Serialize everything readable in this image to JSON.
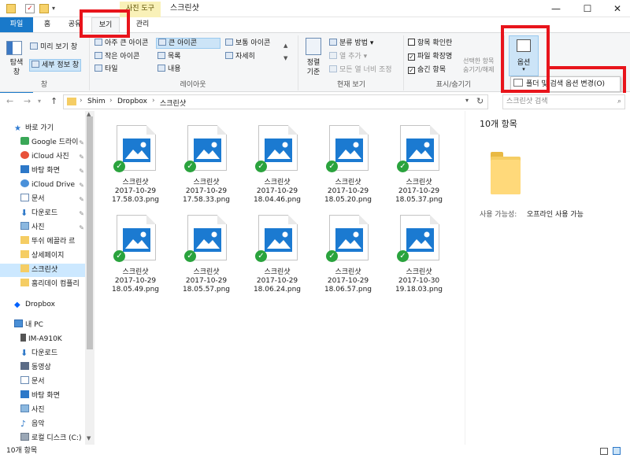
{
  "window": {
    "title": "스크린샷",
    "context_tab": "사진 도구",
    "controls": {
      "minimize": "—",
      "maximize": "☐",
      "close": "✕"
    }
  },
  "tabs": [
    {
      "label": "파일"
    },
    {
      "label": "홈"
    },
    {
      "label": "공유"
    },
    {
      "label": "보기"
    },
    {
      "label": "관리"
    }
  ],
  "ribbon": {
    "panes": {
      "nav_pane": "탐색\n창",
      "preview": "미리 보기 창",
      "details": "세부 정보 창",
      "label": "창"
    },
    "layout": {
      "items": [
        "아주 큰 아이콘",
        "큰 아이콘",
        "보통 아이콘",
        "작은 아이콘",
        "목록",
        "자세히",
        "타일",
        "내용"
      ],
      "label": "레이아웃"
    },
    "current_view": {
      "sort": "정렬\n기준",
      "group_by": "분류 방법",
      "add_columns": "열 추가",
      "fit_columns": "모든 열 너비 조정",
      "label": "현재 보기"
    },
    "show_hide": {
      "item_checkboxes": "항목 확인란",
      "file_extensions": "파일 확장명",
      "hidden_items": "숨긴 항목",
      "hide_selected": "선택한 항목\n숨기기/해제",
      "label": "표시/숨기기"
    },
    "options": {
      "label": "옵션"
    },
    "dropdown": {
      "change_options": "폴더 및 검색 옵션 변경(O)"
    }
  },
  "address": {
    "path": [
      "Shim",
      "Dropbox",
      "스크린샷"
    ],
    "search_placeholder": "스크린샷 검색"
  },
  "nav": {
    "items": [
      {
        "label": "바로 가기",
        "icon": "star-icon"
      },
      {
        "label": "Google 드라이",
        "icon": "google-drive-icon",
        "pinned": true
      },
      {
        "label": "iCloud 사진",
        "icon": "icloud-photos-icon",
        "pinned": true
      },
      {
        "label": "바탕 화면",
        "icon": "desktop-icon",
        "pinned": true
      },
      {
        "label": "iCloud Drive",
        "icon": "icloud-drive-icon",
        "pinned": true
      },
      {
        "label": "문서",
        "icon": "documents-icon",
        "pinned": true
      },
      {
        "label": "다운로드",
        "icon": "download-icon",
        "pinned": true
      },
      {
        "label": "사진",
        "icon": "pictures-icon",
        "pinned": true
      },
      {
        "label": "뚜쉬 에끌라 르",
        "icon": "folder-icon"
      },
      {
        "label": "상세페이지",
        "icon": "folder-icon"
      },
      {
        "label": "스크린샷",
        "icon": "folder-sync-icon",
        "selected": true
      },
      {
        "label": "홈리데이 컴플리",
        "icon": "folder-icon"
      },
      {
        "label": "Dropbox",
        "icon": "dropbox-icon"
      },
      {
        "label": "내 PC",
        "icon": "pc-icon"
      },
      {
        "label": "IM-A910K",
        "icon": "phone-icon"
      },
      {
        "label": "다운로드",
        "icon": "download-icon"
      },
      {
        "label": "동영상",
        "icon": "video-icon"
      },
      {
        "label": "문서",
        "icon": "documents-icon"
      },
      {
        "label": "바탕 화면",
        "icon": "desktop-icon"
      },
      {
        "label": "사진",
        "icon": "pictures-icon"
      },
      {
        "label": "음악",
        "icon": "music-icon"
      },
      {
        "label": "로컬 디스크 (C:)",
        "icon": "disk-icon"
      }
    ]
  },
  "files": [
    {
      "name": "스크린샷",
      "date": "2017-10-29",
      "time": "17.58.03.png"
    },
    {
      "name": "스크린샷",
      "date": "2017-10-29",
      "time": "17.58.33.png"
    },
    {
      "name": "스크린샷",
      "date": "2017-10-29",
      "time": "18.04.46.png"
    },
    {
      "name": "스크린샷",
      "date": "2017-10-29",
      "time": "18.05.20.png"
    },
    {
      "name": "스크린샷",
      "date": "2017-10-29",
      "time": "18.05.37.png"
    },
    {
      "name": "스크린샷",
      "date": "2017-10-29",
      "time": "18.05.49.png"
    },
    {
      "name": "스크린샷",
      "date": "2017-10-29",
      "time": "18.05.57.png"
    },
    {
      "name": "스크린샷",
      "date": "2017-10-29",
      "time": "18.06.24.png"
    },
    {
      "name": "스크린샷",
      "date": "2017-10-29",
      "time": "18.06.57.png"
    },
    {
      "name": "스크린샷",
      "date": "2017-10-30",
      "time": "19.18.03.png"
    }
  ],
  "details": {
    "count": "10개 항목",
    "availability_label": "사용 가능성:",
    "availability_value": "오프라인 사용 가능"
  },
  "status": {
    "count": "10개 항목"
  }
}
